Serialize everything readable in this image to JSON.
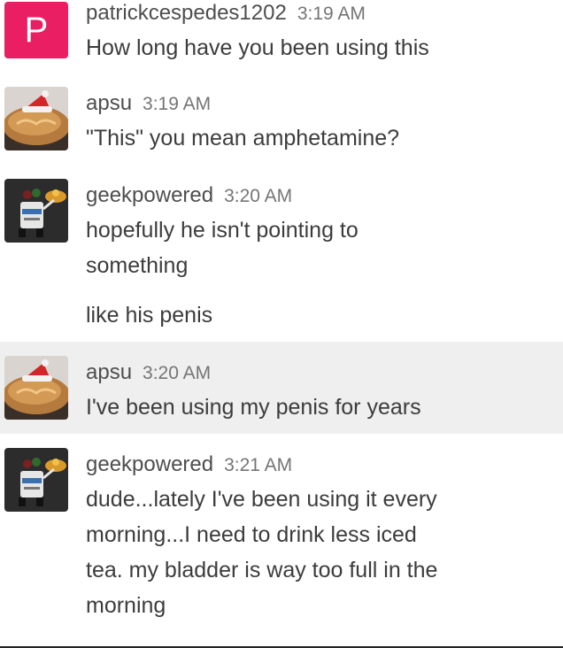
{
  "messages": [
    {
      "user": "patrickcespedes1202",
      "time": "3:19 AM",
      "avatar": {
        "type": "letter",
        "letter": "P",
        "color": "#e91e63"
      },
      "lines": [
        "How long have you been using this"
      ]
    },
    {
      "user": "apsu",
      "time": "3:19 AM",
      "avatar": {
        "type": "image",
        "icon": "bread-santa-hat-avatar"
      },
      "lines": [
        "\"This\" you mean amphetamine?"
      ]
    },
    {
      "user": "geekpowered",
      "time": "3:20 AM",
      "avatar": {
        "type": "image",
        "icon": "robot-avatar"
      },
      "lines": [
        "hopefully he isn't pointing to",
        "something"
      ],
      "followup": "like his penis"
    },
    {
      "user": "apsu",
      "time": "3:20 AM",
      "avatar": {
        "type": "image",
        "icon": "bread-santa-hat-avatar"
      },
      "lines": [
        "I've been using my penis for years"
      ],
      "highlighted": true
    },
    {
      "user": "geekpowered",
      "time": "3:21 AM",
      "avatar": {
        "type": "image",
        "icon": "robot-avatar"
      },
      "lines": [
        "dude...lately I've been using it every",
        "morning...I need to drink less iced",
        "tea. my bladder is way too full in the",
        "morning"
      ]
    }
  ]
}
